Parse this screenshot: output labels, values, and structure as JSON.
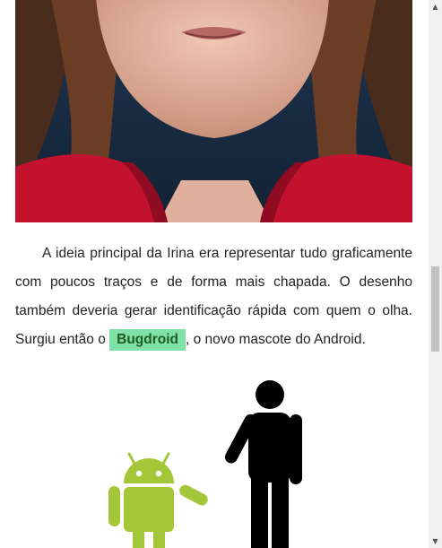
{
  "article": {
    "paragraph": {
      "text_before": "A ideia principal da Irina era representar tudo graficamente com poucos traços e de forma mais chapada. O desenho também deveria gerar identificação rápida com quem o olha. Surgiu então o ",
      "highlight": "Bugdroid",
      "text_after": ", o novo mascote do Android."
    }
  },
  "colors": {
    "highlight_bg": "#7fe0a8",
    "android_green": "#a4c639",
    "figure_black": "#000000"
  },
  "icons": {
    "scroll_up": "▲",
    "scroll_down": "▼"
  }
}
